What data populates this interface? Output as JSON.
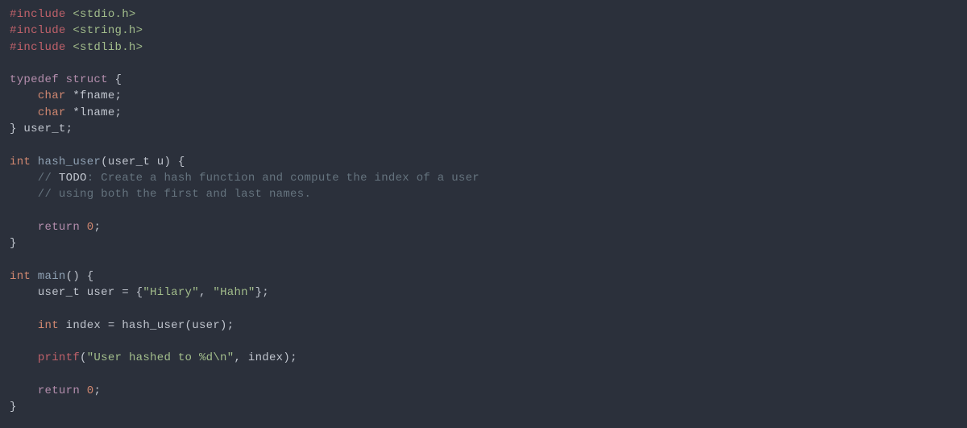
{
  "code": {
    "line1_include": "#include",
    "line1_lib": " <stdio.h>",
    "line2_include": "#include",
    "line2_lib": " <string.h>",
    "line3_include": "#include",
    "line3_lib": " <stdlib.h>",
    "typedef": "typedef",
    "struct": "struct",
    "brace_open": " {",
    "char": "char",
    "fname": " *fname;",
    "lname": " *lname;",
    "close_struct": "} ",
    "user_t": "user_t",
    "semi": ";",
    "int": "int",
    "hash_user": " hash_user",
    "hash_user_paren": "(",
    "user_t_param": "user_t",
    "u_param": " u) {",
    "comment1_pre": "    // ",
    "todo": "TODO",
    "comment1_post": ": Create a hash function and compute the index of a user",
    "comment2": "    // using both the first and last names.",
    "return": "return",
    "zero": " 0",
    "semi2": ";",
    "close_brace": "}",
    "main": " main",
    "main_sig": "() {",
    "user_t_var": "user_t",
    "user_decl": " user = {",
    "hilary": "\"Hilary\"",
    "comma": ", ",
    "hahn": "\"Hahn\"",
    "close_init": "};",
    "int2": "int",
    "index_decl": " index = hash_user(user);",
    "printf": "printf",
    "printf_open": "(",
    "printf_str": "\"User hashed to %d\\n\"",
    "printf_rest": ", index);",
    "indent": "    "
  }
}
